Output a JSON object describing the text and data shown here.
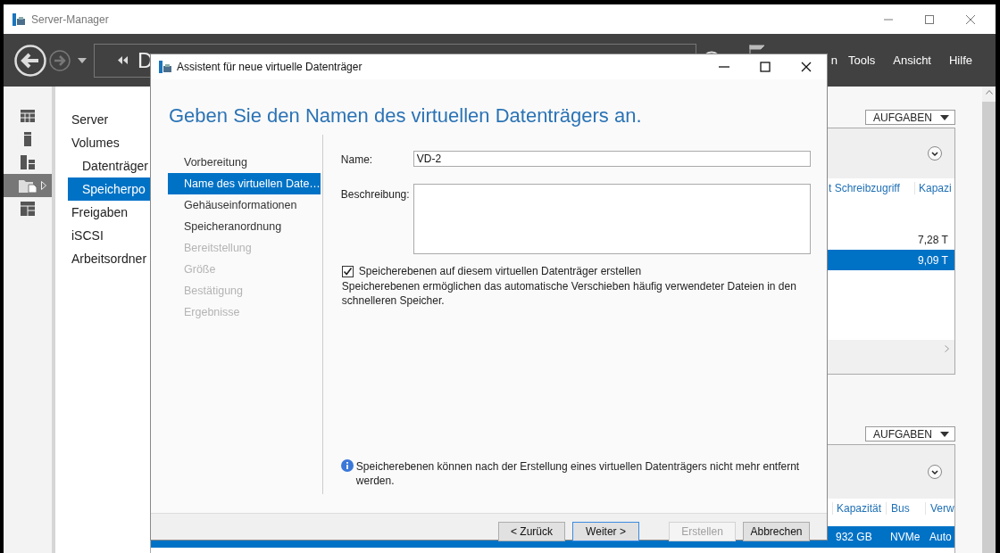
{
  "window": {
    "title": "Server-Manager"
  },
  "toolbar": {
    "breadcrumb": "D",
    "menu": [
      "n",
      "Tools",
      "Ansicht",
      "Hilfe"
    ]
  },
  "icon_strip": [
    {
      "kind": "grid",
      "selected": false
    },
    {
      "kind": "server",
      "selected": false
    },
    {
      "kind": "servers",
      "selected": false
    },
    {
      "kind": "files",
      "selected": true
    },
    {
      "kind": "roles",
      "selected": false
    }
  ],
  "nav": [
    {
      "label": "Server",
      "selected": false
    },
    {
      "label": "Volumes",
      "selected": false,
      "children": [
        {
          "label": "Datenträger",
          "selected": false
        },
        {
          "label": "Speicherpo",
          "selected": true
        }
      ]
    },
    {
      "label": "Freigaben",
      "selected": false
    },
    {
      "label": "iSCSI",
      "selected": false
    },
    {
      "label": "Arbeitsordner",
      "selected": false
    }
  ],
  "upper_panel": {
    "tasks_button": "AUFGABEN",
    "columns": [
      "t Schreibzugriff",
      "Kapazi"
    ],
    "rows": [
      {
        "cells": [
          "",
          "7,28 T"
        ],
        "selected": false
      },
      {
        "cells": [
          "",
          "9,09 T"
        ],
        "selected": true
      }
    ]
  },
  "lower_panel": {
    "tasks_button": "AUFGABEN",
    "columns": [
      "Kapazität",
      "Bus",
      "Verw"
    ],
    "rows": [
      {
        "cells": [
          "932 GB",
          "NVMe",
          "Auto"
        ],
        "selected": true
      }
    ]
  },
  "dialog": {
    "title": "Assistent für neue virtuelle Datenträger",
    "heading": "Geben Sie den Namen des virtuellen Datenträgers an.",
    "steps": [
      {
        "label": "Vorbereitung",
        "selected": false,
        "disabled": false
      },
      {
        "label": "Name des virtuellen Date…",
        "selected": true,
        "disabled": false
      },
      {
        "label": "Gehäuseinformationen",
        "selected": false,
        "disabled": false
      },
      {
        "label": "Speicheranordnung",
        "selected": false,
        "disabled": false
      },
      {
        "label": "Bereitstellung",
        "selected": false,
        "disabled": true
      },
      {
        "label": "Größe",
        "selected": false,
        "disabled": true
      },
      {
        "label": "Bestätigung",
        "selected": false,
        "disabled": true
      },
      {
        "label": "Ergebnisse",
        "selected": false,
        "disabled": true
      }
    ],
    "name_label": "Name:",
    "name_value": "VD-2",
    "description_label": "Beschreibung:",
    "tiering": {
      "label": "Speicherebenen auf diesem virtuellen Datenträger erstellen",
      "checked": true,
      "hint": "Speicherebenen ermöglichen das automatische Verschieben häufig verwendeter Dateien in den schnelleren Speicher."
    },
    "info": "Speicherebenen können nach der Erstellung eines virtuellen Datenträgers nicht mehr entfernt werden.",
    "buttons": [
      {
        "label": "< Zurück",
        "disabled": false,
        "default": false
      },
      {
        "label": "Weiter >",
        "disabled": false,
        "default": true
      },
      {
        "label": "Erstellen",
        "disabled": true,
        "default": false
      },
      {
        "label": "Abbrechen",
        "disabled": false,
        "default": false
      }
    ]
  }
}
